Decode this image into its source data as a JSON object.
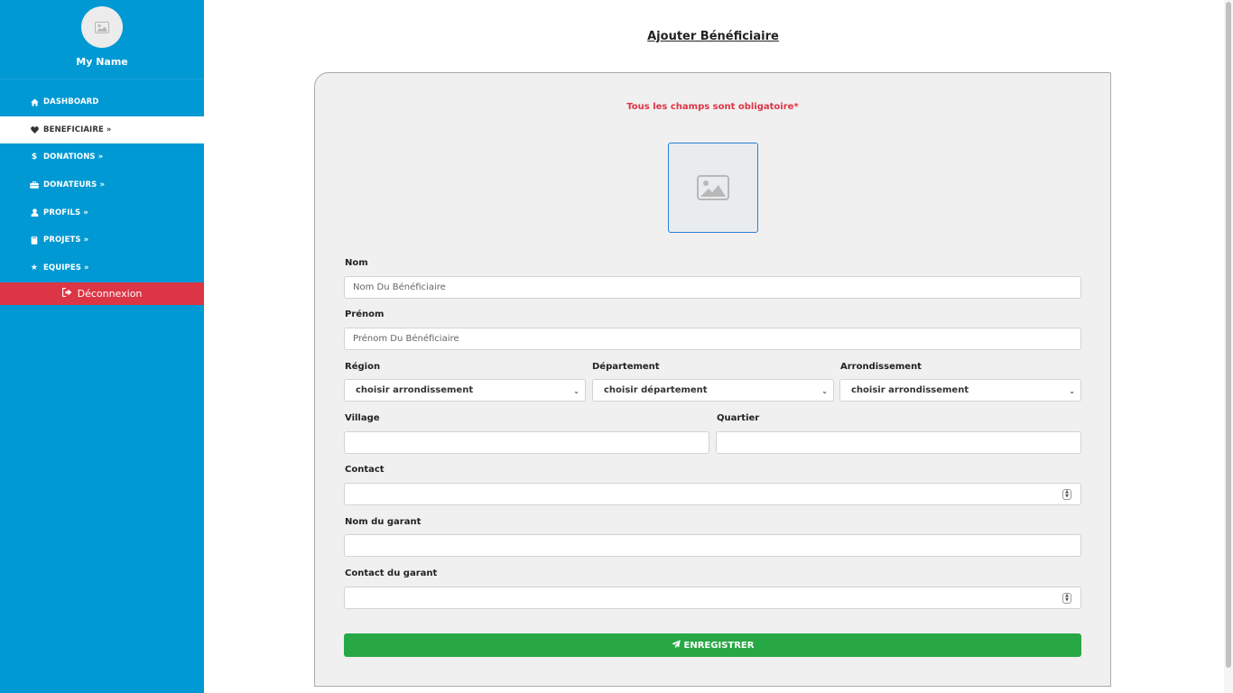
{
  "sidebar": {
    "profile_name": "My Name",
    "items": [
      {
        "label": "DASHBOARD",
        "icon": "home-icon"
      },
      {
        "label": "BENEFICIAIRE »",
        "icon": "heart-icon"
      },
      {
        "label": "DONATIONS »",
        "icon": "dollar-icon"
      },
      {
        "label": "DONATEURS »",
        "icon": "briefcase-icon"
      },
      {
        "label": "PROFILS »",
        "icon": "user-icon"
      },
      {
        "label": "PROJETS »",
        "icon": "book-icon"
      },
      {
        "label": "EQUIPES »",
        "icon": "star-icon"
      }
    ],
    "logout_label": "Déconnexion",
    "active_item": "BENEFICIAIRE »"
  },
  "page": {
    "title": "Ajouter Bénéficiaire",
    "notice": "Tous les champs sont obligatoire*"
  },
  "form": {
    "nom": {
      "label": "Nom",
      "placeholder": "Nom Du Bénéficiaire"
    },
    "prenom": {
      "label": "Prénom",
      "placeholder": "Prénom Du Bénéficiaire"
    },
    "region": {
      "label": "Région",
      "value": "choisir arrondissement"
    },
    "departement": {
      "label": "Département",
      "value": "choisir département"
    },
    "arrondissement": {
      "label": "Arrondissement",
      "value": "choisir arrondissement"
    },
    "village": {
      "label": "Village"
    },
    "quartier": {
      "label": "Quartier"
    },
    "contact": {
      "label": "Contact"
    },
    "nom_garant": {
      "label": "Nom du garant"
    },
    "contact_garant": {
      "label": "Contact du garant"
    },
    "submit_label": "ENREGISTRER"
  },
  "colors": {
    "sidebar": "#0099d3",
    "logout": "#dc3545",
    "submit": "#28a745",
    "notice": "#dc3545"
  }
}
